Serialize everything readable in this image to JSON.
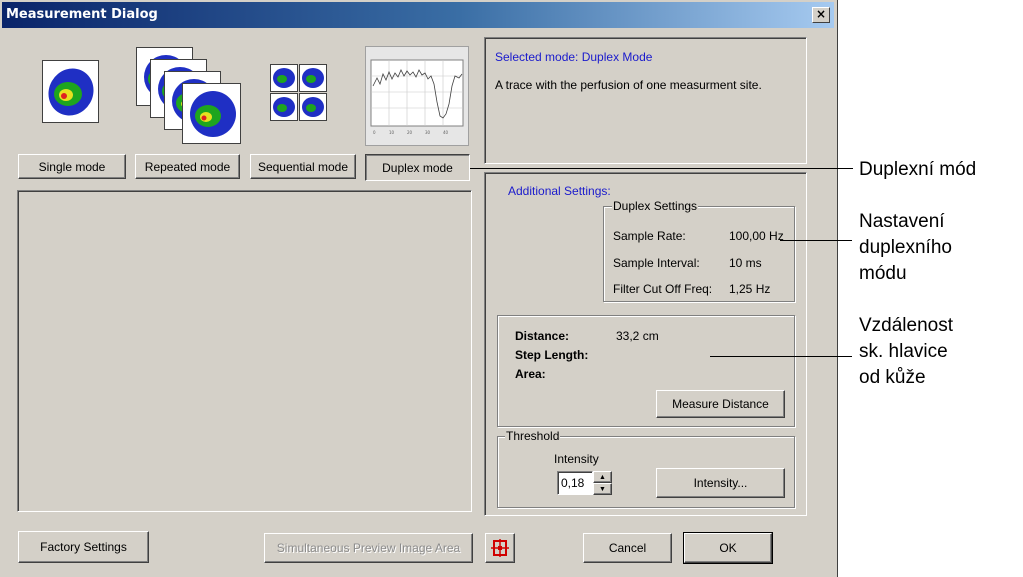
{
  "window": {
    "title": "Measurement Dialog",
    "close_label": "×"
  },
  "modes": {
    "single": "Single mode",
    "repeated": "Repeated mode",
    "sequential": "Sequential mode",
    "duplex": "Duplex mode"
  },
  "selected_panel": {
    "title": "Selected mode: Duplex Mode",
    "description": "A trace with the perfusion of one measurment site."
  },
  "additional": {
    "label": "Additional Settings:",
    "duplex_group": "Duplex Settings",
    "rows": [
      {
        "label": "Sample Rate:",
        "value": "100,00 Hz"
      },
      {
        "label": "Sample Interval:",
        "value": "10 ms"
      },
      {
        "label": "Filter Cut Off Freq:",
        "value": "1,25 Hz"
      }
    ]
  },
  "distance": {
    "distance_label": "Distance:",
    "distance_value": "33,2 cm",
    "step_label": "Step Length:",
    "area_label": "Area:",
    "measure_button": "Measure Distance"
  },
  "threshold": {
    "group": "Threshold",
    "intensity_label": "Intensity",
    "intensity_value": "0,18",
    "intensity_button": "Intensity..."
  },
  "footer": {
    "factory": "Factory Settings",
    "preview": "Simultaneous Preview Image Area",
    "cancel": "Cancel",
    "ok": "OK"
  },
  "annotations": {
    "duplex": "Duplexní mód",
    "settings_1": "Nastavení",
    "settings_2": "duplexního",
    "settings_3": "módu",
    "dist_1": "Vzdálenost",
    "dist_2": "sk. hlavice",
    "dist_3": "od kůže"
  },
  "colors": {
    "title_bar": "#0a246a",
    "dialog_bg": "#d4d0c8",
    "accent_text": "#1a1acc"
  }
}
